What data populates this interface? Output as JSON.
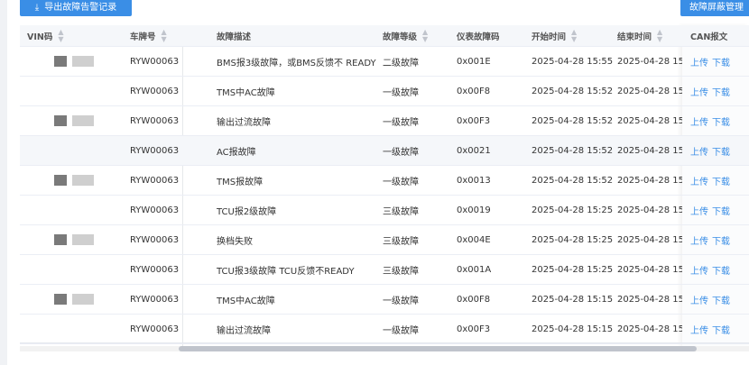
{
  "toolbar": {
    "export_label": "导出故障告警记录",
    "export_icon": "download-icon",
    "manage_label": "故障屏蔽管理"
  },
  "table": {
    "headers": {
      "vin": "VIN码",
      "plate": "车牌号",
      "desc": "故障描述",
      "level": "故障等级",
      "code": "仪表故障码",
      "start": "开始时间",
      "end": "结束时间",
      "can": "CAN报文"
    },
    "link_upload": "上传",
    "link_download": "下载",
    "rows": [
      {
        "plate": "RYW00063",
        "desc": "BMS报3级故障，或BMS反馈不 READY",
        "level": "二级故障",
        "code": "0x001E",
        "start": "2025-04-28 15:55",
        "end": "2025-04-28 15:5"
      },
      {
        "plate": "RYW00063",
        "desc": "TMS中AC故障",
        "level": "一级故障",
        "code": "0x00F8",
        "start": "2025-04-28 15:52",
        "end": "2025-04-28 15:5"
      },
      {
        "plate": "RYW00063",
        "desc": "输出过流故障",
        "level": "一级故障",
        "code": "0x00F3",
        "start": "2025-04-28 15:52",
        "end": "2025-04-28 15:5"
      },
      {
        "plate": "RYW00063",
        "desc": "AC报故障",
        "level": "一级故障",
        "code": "0x0021",
        "start": "2025-04-28 15:52",
        "end": "2025-04-28 15:5"
      },
      {
        "plate": "RYW00063",
        "desc": "TMS报故障",
        "level": "一级故障",
        "code": "0x0013",
        "start": "2025-04-28 15:52",
        "end": "2025-04-28 15:5"
      },
      {
        "plate": "RYW00063",
        "desc": "TCU报2级故障",
        "level": "三级故障",
        "code": "0x0019",
        "start": "2025-04-28 15:25",
        "end": "2025-04-28 15:2"
      },
      {
        "plate": "RYW00063",
        "desc": "换档失败",
        "level": "三级故障",
        "code": "0x004E",
        "start": "2025-04-28 15:25",
        "end": "2025-04-28 15:2"
      },
      {
        "plate": "RYW00063",
        "desc": "TCU报3级故障 TCU反馈不READY",
        "level": "三级故障",
        "code": "0x001A",
        "start": "2025-04-28 15:25",
        "end": "2025-04-28 15:2"
      },
      {
        "plate": "RYW00063",
        "desc": "TMS中AC故障",
        "level": "一级故障",
        "code": "0x00F8",
        "start": "2025-04-28 15:15",
        "end": "2025-04-28 15:1"
      },
      {
        "plate": "RYW00063",
        "desc": "输出过流故障",
        "level": "一级故障",
        "code": "0x00F3",
        "start": "2025-04-28 15:15",
        "end": "2025-04-28 15:1"
      }
    ]
  }
}
